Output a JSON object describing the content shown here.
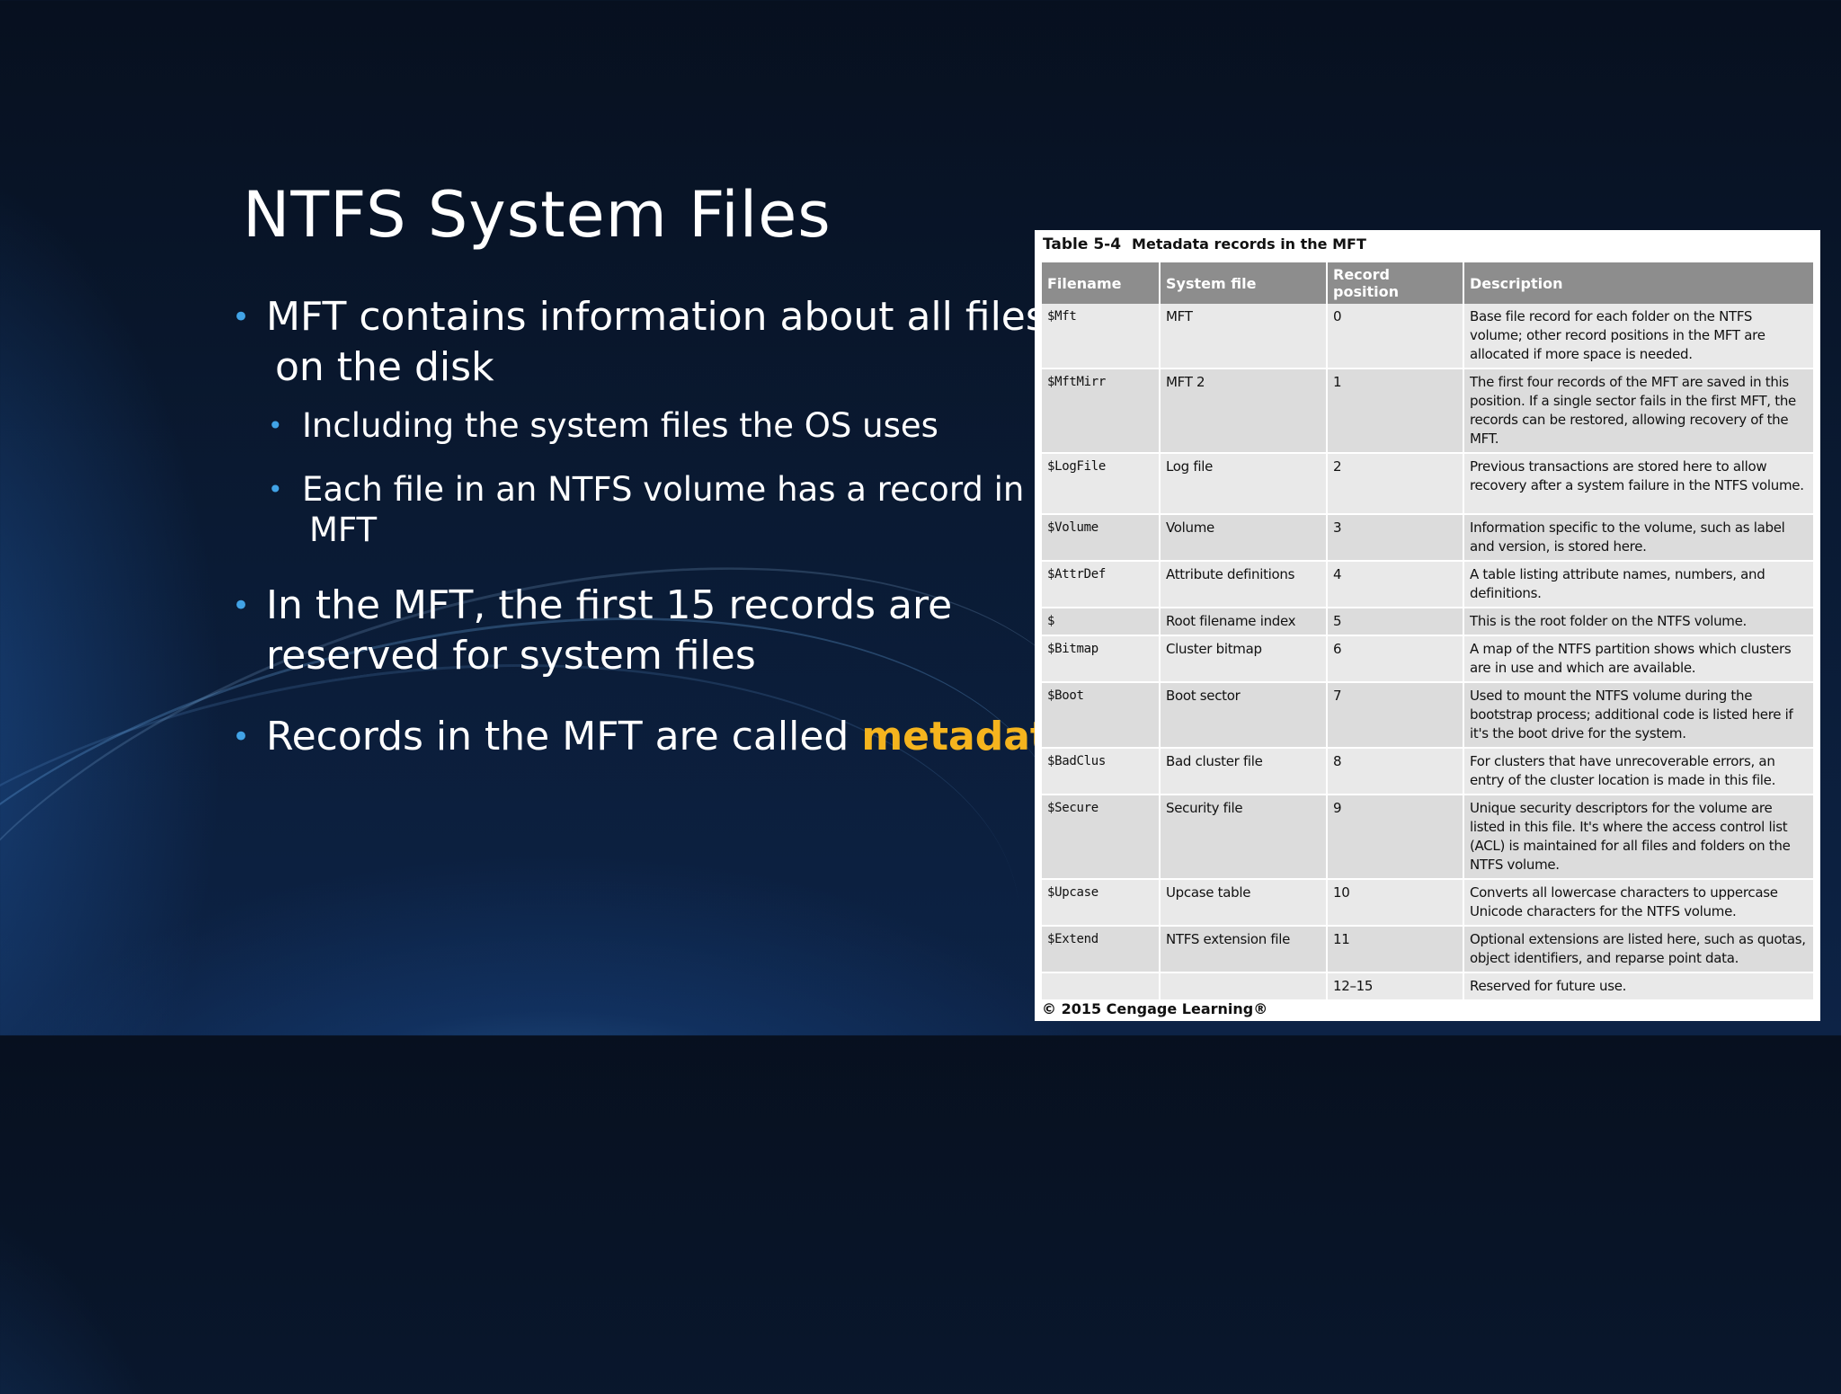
{
  "slide": {
    "title": "NTFS System Files",
    "bullets": {
      "b1_line1": "MFT contains information about all files",
      "b1_line2": "on the disk",
      "sub1": "Including the system files the OS uses",
      "sub2_line1": "Each file in an NTFS volume has a record in the",
      "sub2_line2": "MFT",
      "b2_line1": "In the MFT, the first 15 records are",
      "b2_line2": "reserved for system files",
      "b3_text": "Records in the MFT are called ",
      "b3_highlight": "metadata"
    },
    "accent_color": "#f5b41e",
    "bullet_color": "#41a3e6"
  },
  "table": {
    "label": "Table 5-4",
    "title": "Metadata records in the MFT",
    "headers": [
      "Filename",
      "System file",
      "Record position",
      "Description"
    ],
    "rows": [
      [
        "$Mft",
        "MFT",
        "0",
        "Base file record for each folder on the NTFS volume; other record positions in the MFT are allocated if more space is needed."
      ],
      [
        "$MftMirr",
        "MFT 2",
        "1",
        "The first four records of the MFT are saved in this position. If a single sector fails in the first MFT, the records can be restored, allowing recovery of the MFT."
      ],
      [
        "$LogFile",
        "Log file",
        "2",
        "Previous transactions are stored here to allow recovery after a system failure in the NTFS volume."
      ],
      [
        "$Volume",
        "Volume",
        "3",
        "Information specific to the volume, such as label and version, is stored here."
      ],
      [
        "$AttrDef",
        "Attribute definitions",
        "4",
        "A table listing attribute names, numbers, and definitions."
      ],
      [
        "$",
        "Root filename index",
        "5",
        "This is the root folder on the NTFS volume."
      ],
      [
        "$Bitmap",
        "Cluster bitmap",
        "6",
        "A map of the NTFS partition shows which clusters are in use and which are available."
      ],
      [
        "$Boot",
        "Boot sector",
        "7",
        "Used to mount the NTFS volume during the bootstrap process; additional code is listed here if it's the boot drive for the system."
      ],
      [
        "$BadClus",
        "Bad cluster file",
        "8",
        "For clusters that have unrecoverable errors, an entry of the cluster location is made in this file."
      ],
      [
        "$Secure",
        "Security file",
        "9",
        "Unique security descriptors for the volume are listed in this file. It's where the access control list (ACL) is maintained for all files and folders on the NTFS volume."
      ],
      [
        "$Upcase",
        "Upcase table",
        "10",
        "Converts all lowercase characters to uppercase Unicode characters for the NTFS volume."
      ],
      [
        "$Extend",
        "NTFS extension file",
        "11",
        "Optional extensions are listed here, such as quotas, object identifiers, and reparse point data."
      ],
      [
        "",
        "",
        "12–15",
        "Reserved for future use."
      ]
    ],
    "footer": "© 2015 Cengage Learning®"
  }
}
